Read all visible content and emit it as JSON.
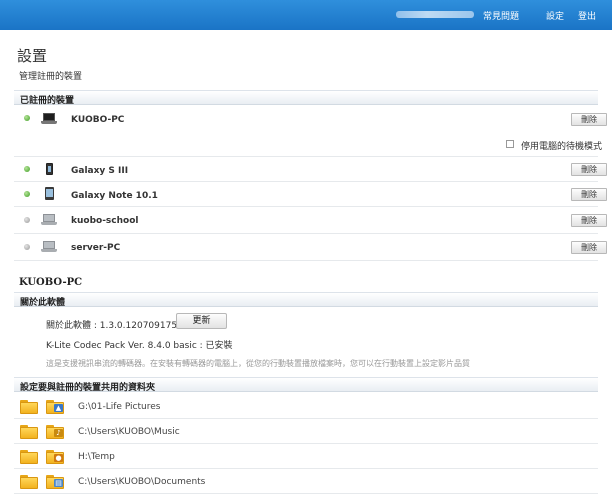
{
  "topbar": {
    "nav": [
      {
        "label": "常見問題"
      },
      {
        "label": "設定"
      },
      {
        "label": "登出"
      }
    ]
  },
  "page": {
    "title": "設置",
    "subtitle": "管理註冊的裝置"
  },
  "registered": {
    "heading": "已註冊的裝置",
    "delete_label": "刪除",
    "sleep_option_label": "停用電腦的待機模式",
    "devices": [
      {
        "name": "KUOBO-PC",
        "status": "online",
        "icon": "laptop-icon"
      },
      {
        "name": "Galaxy S III",
        "status": "online",
        "icon": "phone-icon"
      },
      {
        "name": "Galaxy Note 10.1",
        "status": "online",
        "icon": "tablet-icon"
      },
      {
        "name": "kuobo-school",
        "status": "offline",
        "icon": "laptop-icon"
      },
      {
        "name": "server-PC",
        "status": "offline",
        "icon": "laptop-icon"
      }
    ]
  },
  "pc": {
    "title": "KUOBO-PC",
    "about_heading": "關於此軟體",
    "about_version": "關於此軟體 : 1.3.0.1207091759",
    "update_label": "更新",
    "codec": "K-Lite Codec Pack Ver. 8.4.0 basic : 已安裝",
    "codec_desc": "這是支援視訊串流的轉碼器。在安裝有轉碼器的電腦上，從您的行動裝置播放檔案時，您可以在行動裝置上設定影片品質"
  },
  "shared": {
    "heading": "設定要與註冊的裝置共用的資料夾",
    "folders": [
      {
        "path": "G:\\01-Life Pictures",
        "type": "pictures"
      },
      {
        "path": "C:\\Users\\KUOBO\\Music",
        "type": "music"
      },
      {
        "path": "H:\\Temp",
        "type": "video"
      },
      {
        "path": "C:\\Users\\KUOBO\\Documents",
        "type": "documents"
      }
    ]
  },
  "colors": {
    "topbar": "#1a74c6",
    "online": "#3f9d24",
    "offline": "#9a9a9a",
    "folder": "#f2b21f"
  }
}
